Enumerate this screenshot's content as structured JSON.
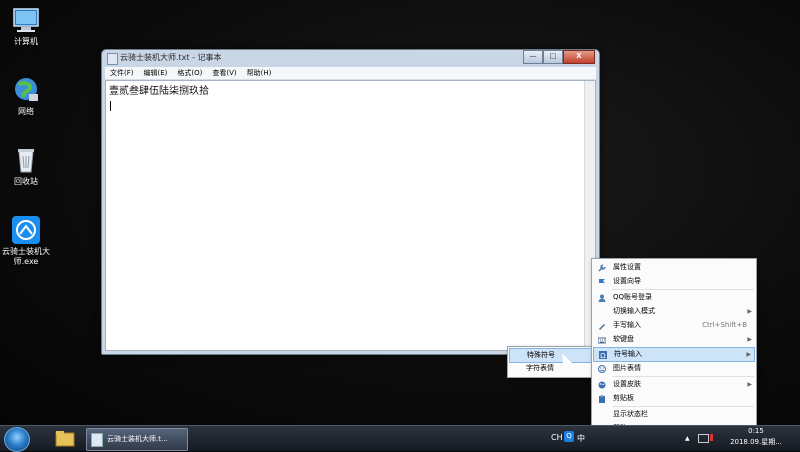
{
  "desktop": {
    "icons": [
      {
        "label": "计算机"
      },
      {
        "label": "网络"
      },
      {
        "label": "回收站"
      },
      {
        "label": "云骑士装机大师.exe"
      }
    ]
  },
  "notepad": {
    "title": "云骑士装机大师.txt - 记事本",
    "menu": [
      "文件(F)",
      "编辑(E)",
      "格式(O)",
      "查看(V)",
      "帮助(H)"
    ],
    "content": "壹贰叁肆伍陆柒捌玖拾",
    "buttons": {
      "minimize": "—",
      "maximize": "□",
      "close": "X"
    }
  },
  "ime_menu": {
    "items": [
      {
        "label": "属性设置",
        "icon": "wrench-icon",
        "color": "#3a6fb0"
      },
      {
        "label": "设置向导",
        "icon": "flag-icon",
        "color": "#2f7dd1"
      },
      {
        "label": "QQ账号登录",
        "icon": "user-icon",
        "color": "#4a7fb8"
      },
      {
        "label": "切换输入模式",
        "submenu": true
      },
      {
        "label": "手写输入",
        "icon": "pen-icon",
        "shortcut": "Ctrl+Shift+B",
        "color": "#4b6c94"
      },
      {
        "label": "软键盘",
        "icon": "keyboard-icon",
        "submenu": true,
        "color": "#4b6c94"
      },
      {
        "label": "符号输入",
        "icon": "omega-icon",
        "submenu": true,
        "highlighted": true,
        "color": "#3a6fb0"
      },
      {
        "label": "图片表情",
        "icon": "smiley-icon",
        "color": "#3a6fb0"
      },
      {
        "label": "设置皮肤",
        "icon": "paint-icon",
        "submenu": true,
        "color": "#3a6fb0"
      },
      {
        "label": "剪贴板",
        "icon": "clipboard-icon",
        "color": "#3a6fb0"
      },
      {
        "label": "显示状态栏"
      },
      {
        "label": "帮助",
        "icon": "help-icon",
        "submenu": true,
        "color": "#3a6fb0"
      }
    ],
    "submenu": [
      "特殊符号",
      "字符表情"
    ]
  },
  "taskbar": {
    "task_label": "云骑士装机大师.t...",
    "tray": {
      "lang": "CH",
      "ime": "中"
    },
    "clock_time": "0:15",
    "clock_date": "2018.09.星期..."
  }
}
